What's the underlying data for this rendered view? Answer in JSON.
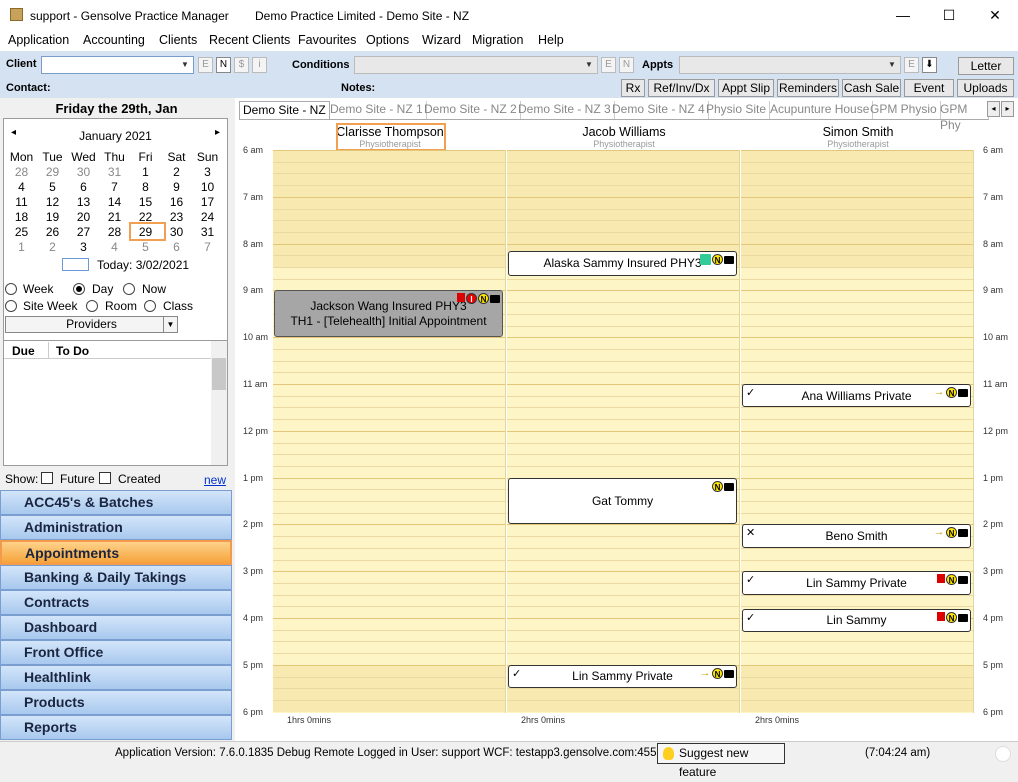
{
  "window": {
    "title_app": "support - Gensolve Practice Manager",
    "title_site": "Demo Practice Limited  - Demo Site - NZ",
    "min": "—",
    "max": "☐",
    "close": "✕"
  },
  "menu": [
    "Application",
    "Accounting",
    "Clients",
    "Recent Clients",
    "Favourites",
    "Options",
    "Wizard",
    "Migration",
    "Help"
  ],
  "toolbar": {
    "client_label": "Client",
    "conditions_label": "Conditions",
    "appts_label": "Appts",
    "contact_label": "Contact:",
    "notes_label": "Notes:",
    "mini": {
      "e": "E",
      "n": "N",
      "dollar": "$",
      "i": "i"
    },
    "letter": "Letter",
    "download": "⬇",
    "buttons": [
      "Rx",
      "Ref/Inv/Dx",
      "Appt Slip",
      "Reminders",
      "Cash Sale",
      "Event",
      "Uploads"
    ]
  },
  "left": {
    "date_header": "Friday the 29th, Jan",
    "month": "January 2021",
    "prev": "◂",
    "next": "▸",
    "dow": [
      "Mon",
      "Tue",
      "Wed",
      "Thu",
      "Fri",
      "Sat",
      "Sun"
    ],
    "weeks": [
      [
        "28",
        "29",
        "30",
        "31",
        "1",
        "2",
        "3"
      ],
      [
        "4",
        "5",
        "6",
        "7",
        "8",
        "9",
        "10"
      ],
      [
        "11",
        "12",
        "13",
        "14",
        "15",
        "16",
        "17"
      ],
      [
        "18",
        "19",
        "20",
        "21",
        "22",
        "23",
        "24"
      ],
      [
        "25",
        "26",
        "27",
        "28",
        "29",
        "30",
        "31"
      ],
      [
        "1",
        "2",
        "3",
        "4",
        "5",
        "6",
        "7"
      ]
    ],
    "today": "Today: 3/02/2021",
    "views": {
      "week": "Week",
      "day": "Day",
      "now": "Now",
      "site_week": "Site Week",
      "room": "Room",
      "class": "Class"
    },
    "providers": "Providers",
    "todo_cols": [
      "Due",
      "To Do"
    ],
    "show_label": "Show:",
    "future": "Future",
    "created": "Created",
    "new": "new",
    "nav": [
      "ACC45's & Batches",
      "Administration",
      "Appointments",
      "Banking & Daily Takings",
      "Contracts",
      "Dashboard",
      "Front Office",
      "Healthlink",
      "Products",
      "Reports"
    ]
  },
  "tabs": [
    "Demo Site - NZ",
    "Demo Site - NZ 1",
    "Demo Site - NZ 2",
    "Demo Site - NZ 3",
    "Demo Site - NZ 4",
    "Physio Site",
    "Acupunture House",
    "GPM Physio",
    "GPM Phy"
  ],
  "providers": [
    {
      "name": "Clarisse Thompson",
      "role": "Physiotherapist",
      "footer": "1hrs 0mins"
    },
    {
      "name": "Jacob Williams",
      "role": "Physiotherapist",
      "footer": "2hrs 0mins"
    },
    {
      "name": "Simon Smith",
      "role": "Physiotherapist",
      "footer": "2hrs 0mins"
    }
  ],
  "times": [
    "6 am",
    "7 am",
    "8 am",
    "9 am",
    "10 am",
    "11 am",
    "12 pm",
    "1 pm",
    "2 pm",
    "3 pm",
    "4 pm",
    "5 pm",
    "6 pm"
  ],
  "appointments": [
    {
      "col": 0,
      "start": 9.0,
      "end": 10.0,
      "line1": "Jackson Wang Insured PHY3",
      "line2": "TH1 - [Telehealth] Initial Appointment",
      "grey": true,
      "mark": ""
    },
    {
      "col": 1,
      "start": 8.15,
      "end": 8.7,
      "line1": "Alaska Sammy Insured PHY3",
      "line2": "",
      "grey": false,
      "mark": ""
    },
    {
      "col": 1,
      "start": 13.0,
      "end": 14.0,
      "line1": "Gat Tommy",
      "line2": "",
      "grey": false,
      "mark": ""
    },
    {
      "col": 1,
      "start": 17.0,
      "end": 17.5,
      "line1": "Lin Sammy Private",
      "line2": "",
      "grey": false,
      "mark": "✓"
    },
    {
      "col": 2,
      "start": 11.0,
      "end": 11.5,
      "line1": "Ana Williams Private",
      "line2": "",
      "grey": false,
      "mark": "✓"
    },
    {
      "col": 2,
      "start": 14.0,
      "end": 14.5,
      "line1": "Beno Smith",
      "line2": "",
      "grey": false,
      "mark": "✕"
    },
    {
      "col": 2,
      "start": 15.0,
      "end": 15.5,
      "line1": "Lin Sammy Private",
      "line2": "",
      "grey": false,
      "mark": "✓"
    },
    {
      "col": 2,
      "start": 15.8,
      "end": 16.3,
      "line1": "Lin Sammy",
      "line2": "",
      "grey": false,
      "mark": "✓"
    }
  ],
  "status": {
    "version": "Application Version: 7.6.0.1835 Debug Remote  Logged in User: support WCF: testapp3.gensolve.com:4551",
    "suggest": "Suggest new feature",
    "time": "(7:04:24 am)"
  }
}
